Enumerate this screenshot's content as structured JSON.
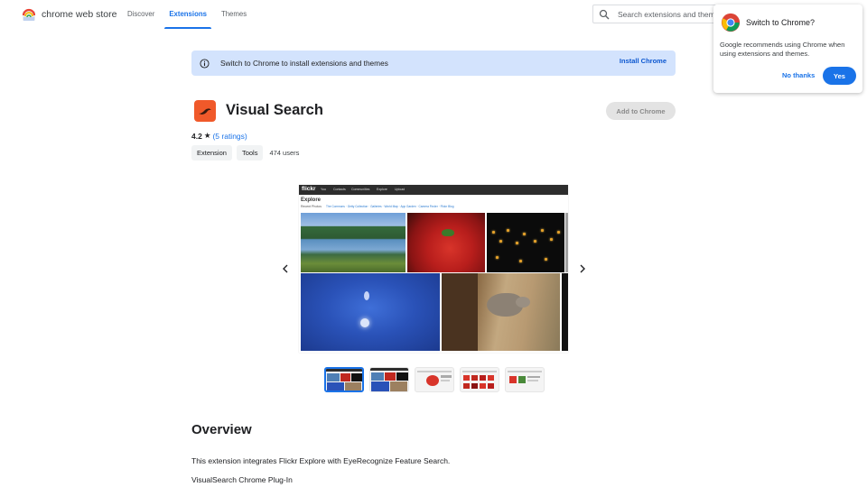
{
  "header": {
    "brand": "chrome web store",
    "nav": [
      {
        "label": "Discover",
        "active": false
      },
      {
        "label": "Extensions",
        "active": true
      },
      {
        "label": "Themes",
        "active": false
      }
    ],
    "search_placeholder": "Search extensions and themes"
  },
  "banner": {
    "text": "Switch to Chrome to install extensions and themes",
    "button": "Install Chrome"
  },
  "extension": {
    "name": "Visual Search",
    "add_button": "Add to Chrome",
    "rating": "4.2",
    "ratings_link": "5 ratings",
    "tags": [
      "Extension",
      "Tools"
    ],
    "users": "474 users",
    "icon_color": "#f0592a"
  },
  "screenshot": {
    "brand": "flickr",
    "menu": [
      "You",
      "Contacts",
      "Communities",
      "Explore",
      "Upload"
    ],
    "heading": "Explore",
    "sub": "Recent Photos",
    "links": "The Commons · Getty Collection · Galleries · World Map · App Garden · Camera Finder · Flickr Blog"
  },
  "overview": {
    "title": "Overview",
    "p1": "This extension integrates Flickr Explore with EyeRecognize Feature Search.",
    "p2": "VisualSearch Chrome Plug-In"
  },
  "popup": {
    "title": "Switch to Chrome?",
    "text": "Google recommends using Chrome when using extensions and themes.",
    "no": "No thanks",
    "yes": "Yes"
  },
  "colors": {
    "accent": "#1a73e8",
    "banner_bg": "#d3e3fd"
  }
}
